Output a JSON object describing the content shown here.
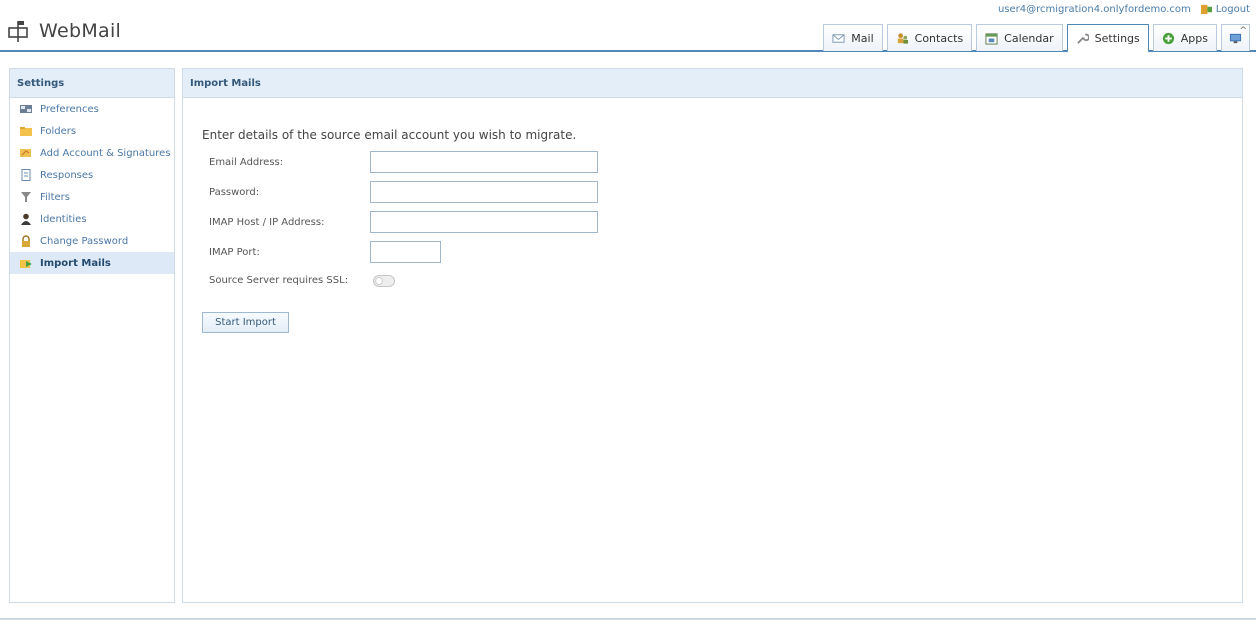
{
  "app": {
    "title": "WebMail"
  },
  "user": {
    "email": "user4@rcmigration4.onlyfordemo.com",
    "logout_label": "Logout"
  },
  "tabs": [
    {
      "label": "Mail",
      "icon": "envelope-icon"
    },
    {
      "label": "Contacts",
      "icon": "contacts-icon"
    },
    {
      "label": "Calendar",
      "icon": "calendar-icon"
    },
    {
      "label": "Settings",
      "icon": "wrench-icon",
      "active": true
    },
    {
      "label": "Apps",
      "icon": "plus-circle-icon"
    },
    {
      "label": "",
      "icon": "monitor-icon"
    }
  ],
  "sidebar": {
    "title": "Settings",
    "items": [
      {
        "label": "Preferences",
        "icon": "preferences-icon"
      },
      {
        "label": "Folders",
        "icon": "folder-icon"
      },
      {
        "label": "Add Account & Signatures",
        "icon": "signature-icon"
      },
      {
        "label": "Responses",
        "icon": "document-icon"
      },
      {
        "label": "Filters",
        "icon": "filter-icon"
      },
      {
        "label": "Identities",
        "icon": "person-icon"
      },
      {
        "label": "Change Password",
        "icon": "lock-icon"
      },
      {
        "label": "Import Mails",
        "icon": "import-icon",
        "active": true
      }
    ]
  },
  "main": {
    "title": "Import Mails",
    "intro": "Enter details of the source email account you wish to migrate.",
    "fields": {
      "email_label": "Email Address:",
      "email_value": "",
      "password_label": "Password:",
      "password_value": "",
      "host_label": "IMAP Host / IP Address:",
      "host_value": "",
      "port_label": "IMAP Port:",
      "port_value": "",
      "ssl_label": "Source Server requires SSL:",
      "ssl_enabled": false
    },
    "start_button": "Start Import"
  },
  "colors": {
    "accent": "#4f88b8",
    "link": "#4b78a5",
    "panel_header": "#e3eef8"
  }
}
